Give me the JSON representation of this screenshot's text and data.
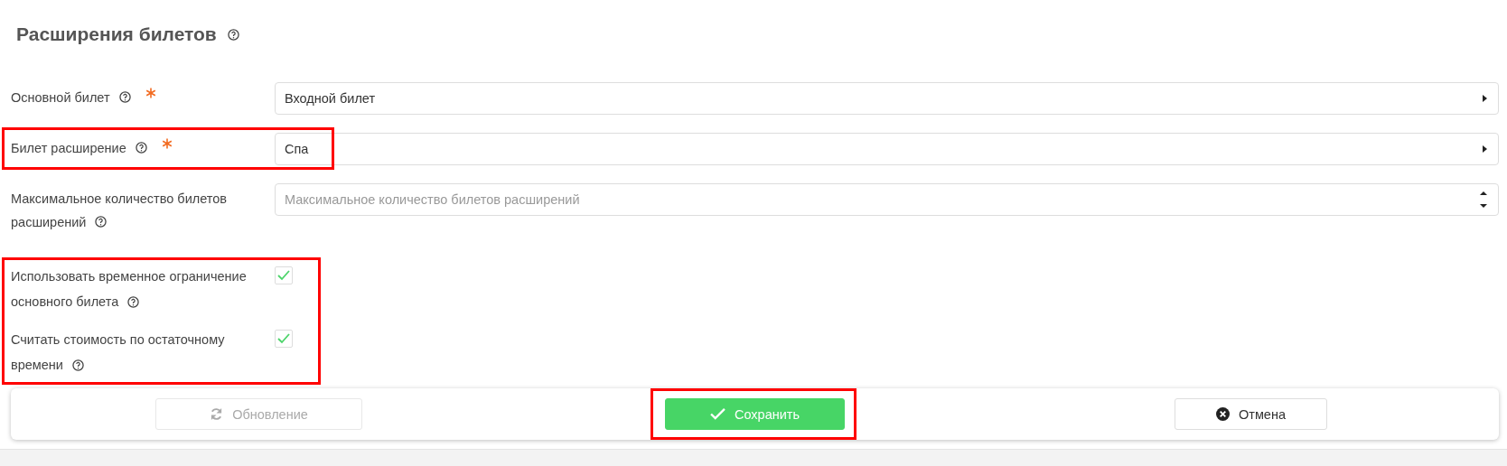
{
  "title": "Расширения билетов",
  "fields": [
    {
      "kind": "select",
      "label": "Основной билет",
      "required": true,
      "highlighted": false,
      "value": "Входной билет"
    },
    {
      "kind": "select",
      "label": "Билет расширение",
      "required": true,
      "highlighted": true,
      "value": "Спа"
    },
    {
      "kind": "number",
      "label": "Максимальное количество билетов расширений",
      "required": false,
      "highlighted": false,
      "placeholder": "Максимальное количество билетов расширений"
    }
  ],
  "checkbox_group": {
    "highlighted": true,
    "items": [
      {
        "label": "Использовать временное ограничение основного билета",
        "checked": true
      },
      {
        "label": "Считать стоимость по остаточному времени",
        "checked": true
      }
    ]
  },
  "buttons": [
    {
      "kind": "refresh",
      "label": "Обновление",
      "disabled": true,
      "highlighted": false
    },
    {
      "kind": "save",
      "label": "Сохранить",
      "disabled": false,
      "highlighted": true
    },
    {
      "kind": "cancel",
      "label": "Отмена",
      "disabled": false,
      "highlighted": false
    }
  ]
}
